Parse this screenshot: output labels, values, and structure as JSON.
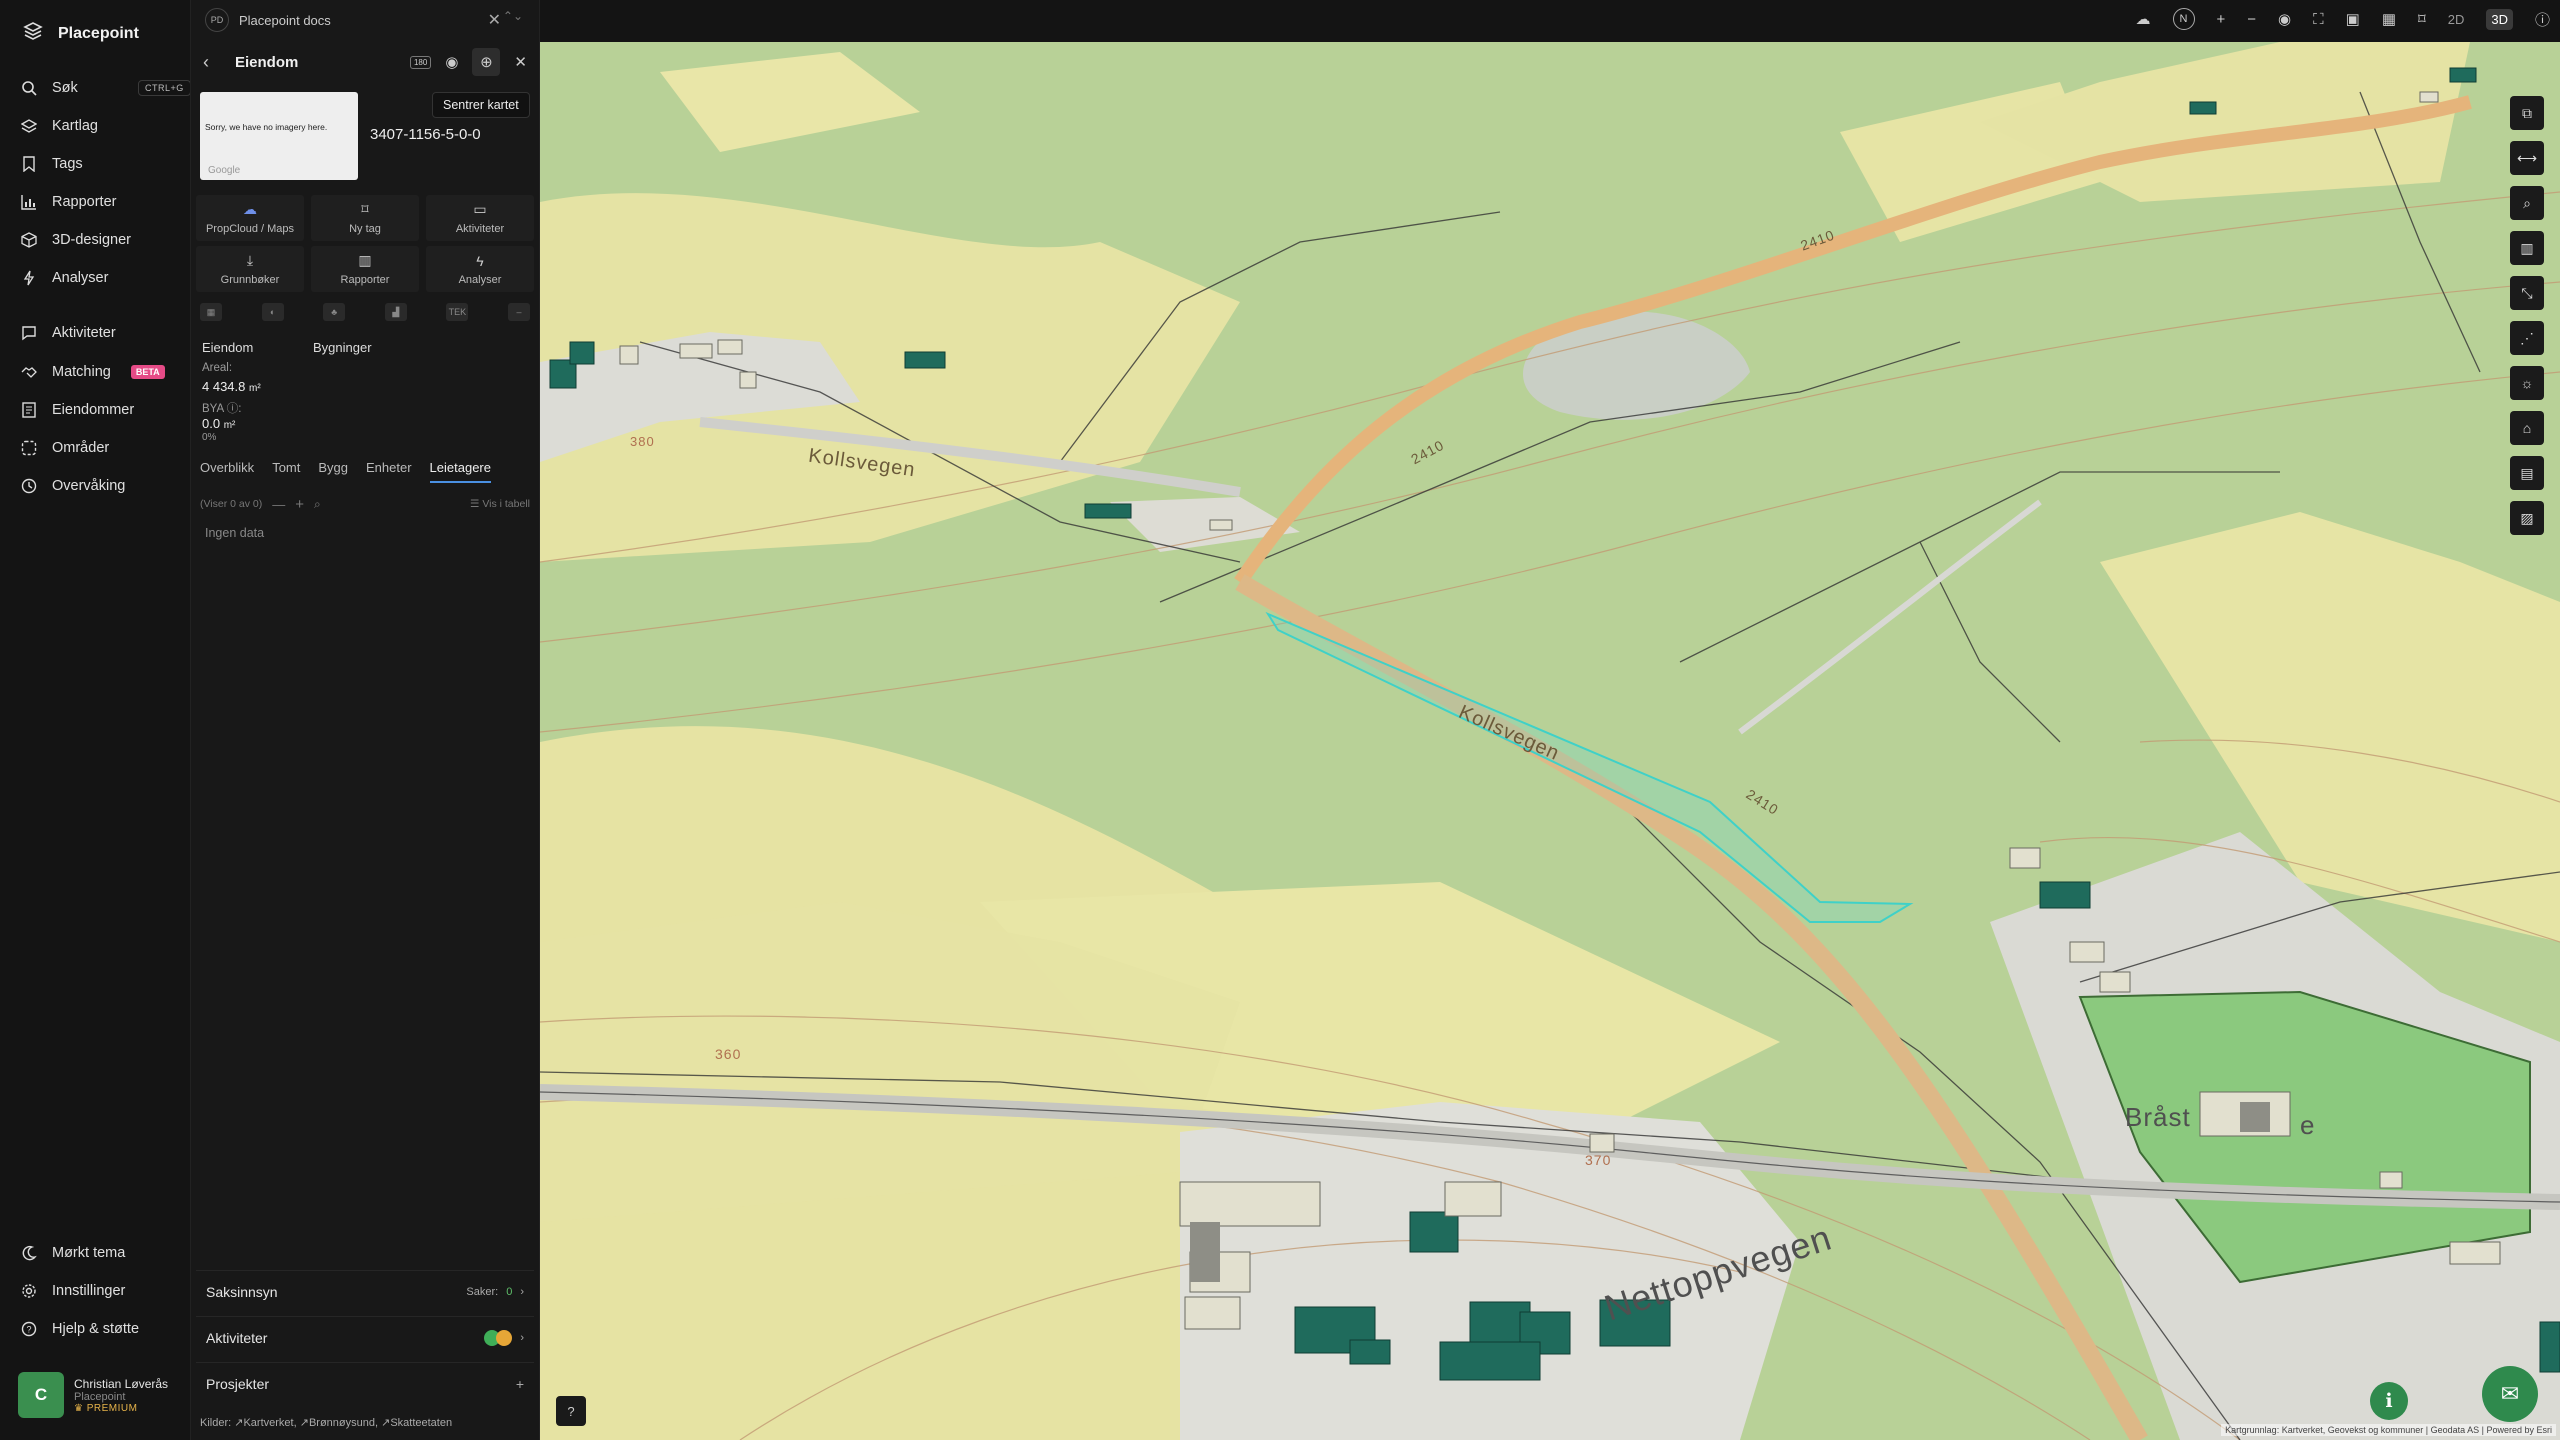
{
  "nav": {
    "brand": "Placepoint",
    "search_label": "Søk",
    "search_shortcut": "CTRL+G",
    "items": [
      {
        "label": "Kartlag"
      },
      {
        "label": "Tags"
      },
      {
        "label": "Rapporter"
      },
      {
        "label": "3D-designer"
      },
      {
        "label": "Analyser"
      },
      {
        "label": "Aktiviteter"
      },
      {
        "label": "Matching"
      },
      {
        "label": "Eiendommer"
      },
      {
        "label": "Områder"
      },
      {
        "label": "Overvåking"
      }
    ],
    "matching_badge": "BETA",
    "bottom": [
      {
        "label": "Mørkt tema"
      },
      {
        "label": "Innstillinger"
      },
      {
        "label": "Hjelp & støtte"
      }
    ],
    "user": {
      "initial": "C",
      "name": "Christian Løverås",
      "org": "Placepoint",
      "plan": "PREMIUM"
    }
  },
  "panel": {
    "tab_badge": "PD",
    "tab_title": "Placepoint docs",
    "header_title": "Eiendom",
    "header_badge": "180",
    "tooltip": "Sentrer kartet",
    "thumbnail_text": "Sorry, we have no imagery here.",
    "thumbnail_google": "Google",
    "property_id": "3407-1156-5-0-0",
    "actions": [
      {
        "label": "PropCloud / Maps"
      },
      {
        "label": "Ny tag"
      },
      {
        "label": "Aktiviteter"
      },
      {
        "label": "Grunnbøker"
      },
      {
        "label": "Rapporter"
      },
      {
        "label": "Analyser"
      }
    ],
    "iconrow_tek": "TEK",
    "sections": {
      "eiendom": "Eiendom",
      "bygninger": "Bygninger"
    },
    "areal_label": "Areal:",
    "areal_value": "4 434.8",
    "areal_unit": "m²",
    "bya_label": "BYA ⓘ:",
    "bya_value": "0.0",
    "bya_unit": "m²",
    "bya_pct": "0%",
    "sub_tabs": [
      "Overblikk",
      "Tomt",
      "Bygg",
      "Enheter",
      "Leietagere"
    ],
    "toolbar_count": "(Viser 0 av 0)",
    "toolbar_table": "Vis i tabell",
    "no_data": "Ingen data",
    "saksinnsyn": "Saksinnsyn",
    "saker_label": "Saker:",
    "saker_count": "0",
    "aktiviteter": "Aktiviteter",
    "prosjekter": "Prosjekter",
    "kilder_label": "Kilder:",
    "kilder": [
      "Kartverket",
      "Brønnøysund",
      "Skatteetaten"
    ]
  },
  "topbar": {
    "view_2d": "2D",
    "view_3d": "3D",
    "north": "N"
  },
  "map": {
    "road_labels": [
      "Kollsvegen",
      "Kollsvegen",
      "Nettoppvegen",
      "Bråst",
      "e"
    ],
    "route_numbers": [
      "2410",
      "2410",
      "2410"
    ],
    "contours": [
      "380",
      "360",
      "370"
    ],
    "attribution": "Kartgrunnlag: Kartverket, Geovekst og kommuner | Geodata AS | Powered by Esri",
    "colors": {
      "field": "#e6e4a6",
      "grass": "#b9d29a",
      "forest": "#a8c48e",
      "road": "#e9b87c",
      "selection": "#3fd1c8",
      "building": "#1f6b5c"
    }
  }
}
